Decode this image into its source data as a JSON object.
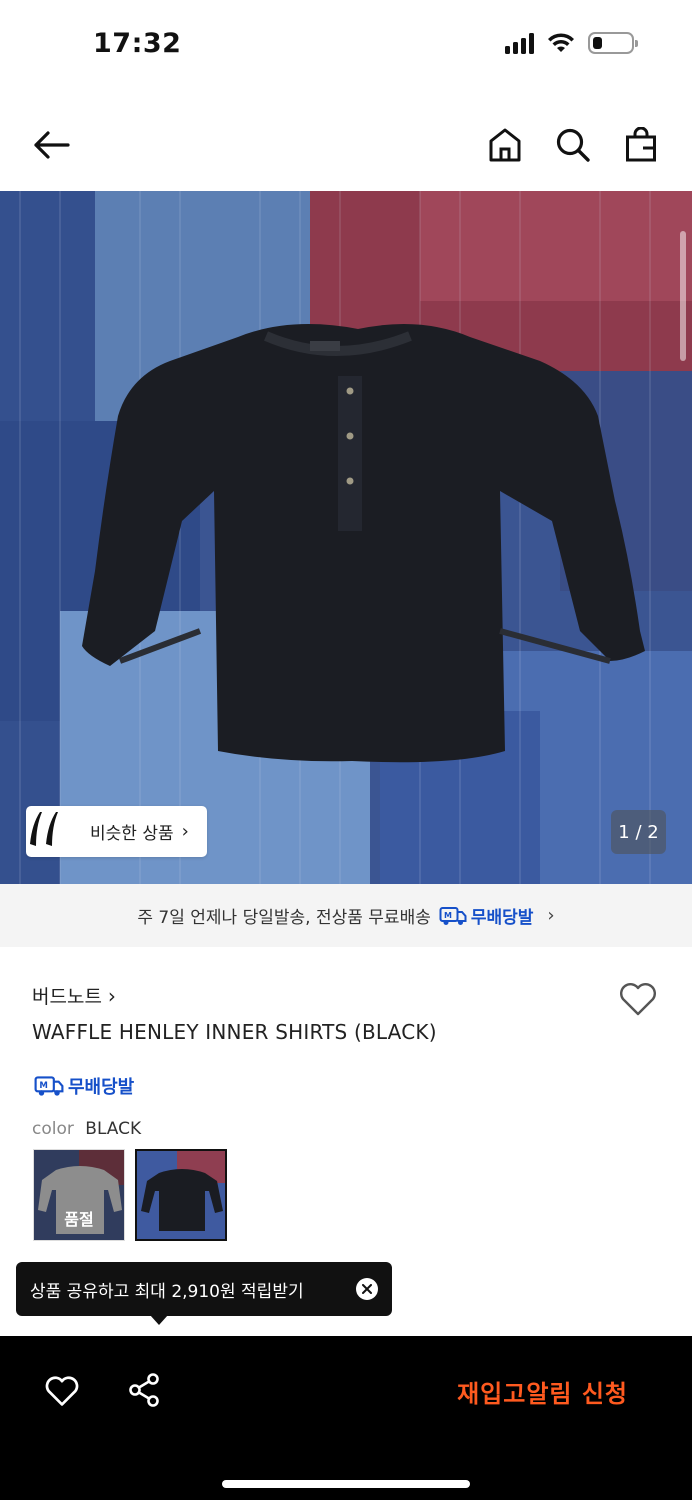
{
  "status_bar": {
    "time": "17:32",
    "battery_level": 0.25
  },
  "nav": {
    "back_icon": "arrow-left-icon",
    "home_icon": "home-icon",
    "search_icon": "search-icon",
    "bag_icon": "shopping-bag-icon"
  },
  "hero": {
    "similar_label": "비슷한 상품",
    "page_indicator": "1 / 2",
    "colors": {
      "quilt_blue": "#3d5a95",
      "quilt_red": "#9a3f52",
      "shirt": "#1a1c22"
    }
  },
  "shipping_banner": {
    "text": "주 7일 언제나 당일발송, 전상품 무료배송",
    "brand": "무배당발"
  },
  "product": {
    "brand": "버드노트",
    "title": "WAFFLE HENLEY INNER SHIRTS (BLACK)",
    "badge": "무배당발",
    "color_key": "color",
    "color_value": "BLACK",
    "swatches": [
      {
        "status": "품절"
      }
    ]
  },
  "tooltip": {
    "text": "상품 공유하고 최대 2,910원 적립받기"
  },
  "bottom_bar": {
    "cta": "재입고알림 신청"
  },
  "theme": {
    "accent_blue": "#1650c9",
    "cta_orange": "#ff5a1f"
  }
}
